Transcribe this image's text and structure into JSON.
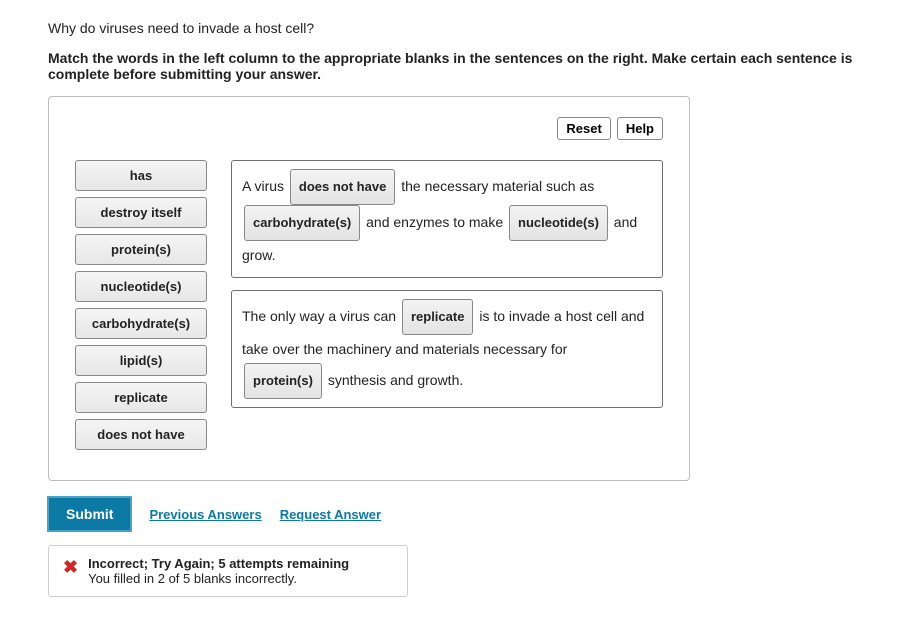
{
  "question": "Why do viruses need to invade a host cell?",
  "instruction": "Match the words in the left column to the appropriate blanks in the sentences on the right. Make certain each sentence is complete before submitting your answer.",
  "controls": {
    "reset": "Reset",
    "help": "Help"
  },
  "words": [
    "has",
    "destroy itself",
    "protein(s)",
    "nucleotide(s)",
    "carbohydrate(s)",
    "lipid(s)",
    "replicate",
    "does not have"
  ],
  "sentence1": {
    "t1": "A virus ",
    "b1": "does not have",
    "t2": " the necessary material such as ",
    "b2": "carbohydrate(s)",
    "t3": " and enzymes to make ",
    "b3": "nucleotide(s)",
    "t4": " and grow."
  },
  "sentence2": {
    "t1": "The only way a virus can ",
    "b1": "replicate",
    "t2": " is to invade a host cell and take over the machinery and materials necessary for ",
    "b2": "protein(s)",
    "t3": " synthesis and growth."
  },
  "actions": {
    "submit": "Submit",
    "prev": "Previous Answers",
    "request": "Request Answer"
  },
  "feedback": {
    "title": "Incorrect; Try Again; 5 attempts remaining",
    "detail": "You filled in 2 of 5 blanks incorrectly."
  }
}
